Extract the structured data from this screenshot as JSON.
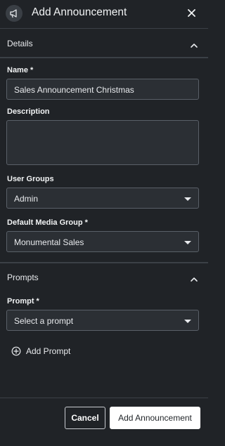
{
  "header": {
    "title": "Add Announcement",
    "logo_icon": "megaphone-icon",
    "close_icon": "close-icon"
  },
  "details": {
    "section_label": "Details",
    "name": {
      "label": "Name *",
      "value": "Sales Announcement Christmas"
    },
    "description": {
      "label": "Description",
      "value": ""
    },
    "user_groups": {
      "label": "User Groups",
      "value": "Admin"
    },
    "default_media_group": {
      "label": "Default Media Group *",
      "value": "Monumental Sales"
    }
  },
  "prompts": {
    "section_label": "Prompts",
    "prompt": {
      "label": "Prompt *",
      "placeholder": "Select a prompt"
    },
    "add_prompt_label": "Add Prompt"
  },
  "footer": {
    "cancel_label": "Cancel",
    "submit_label": "Add Announcement"
  },
  "colors": {
    "background": "#202327",
    "input_background": "#2b2f34",
    "border": "#5a6068",
    "primary_button": "#ffffff"
  }
}
